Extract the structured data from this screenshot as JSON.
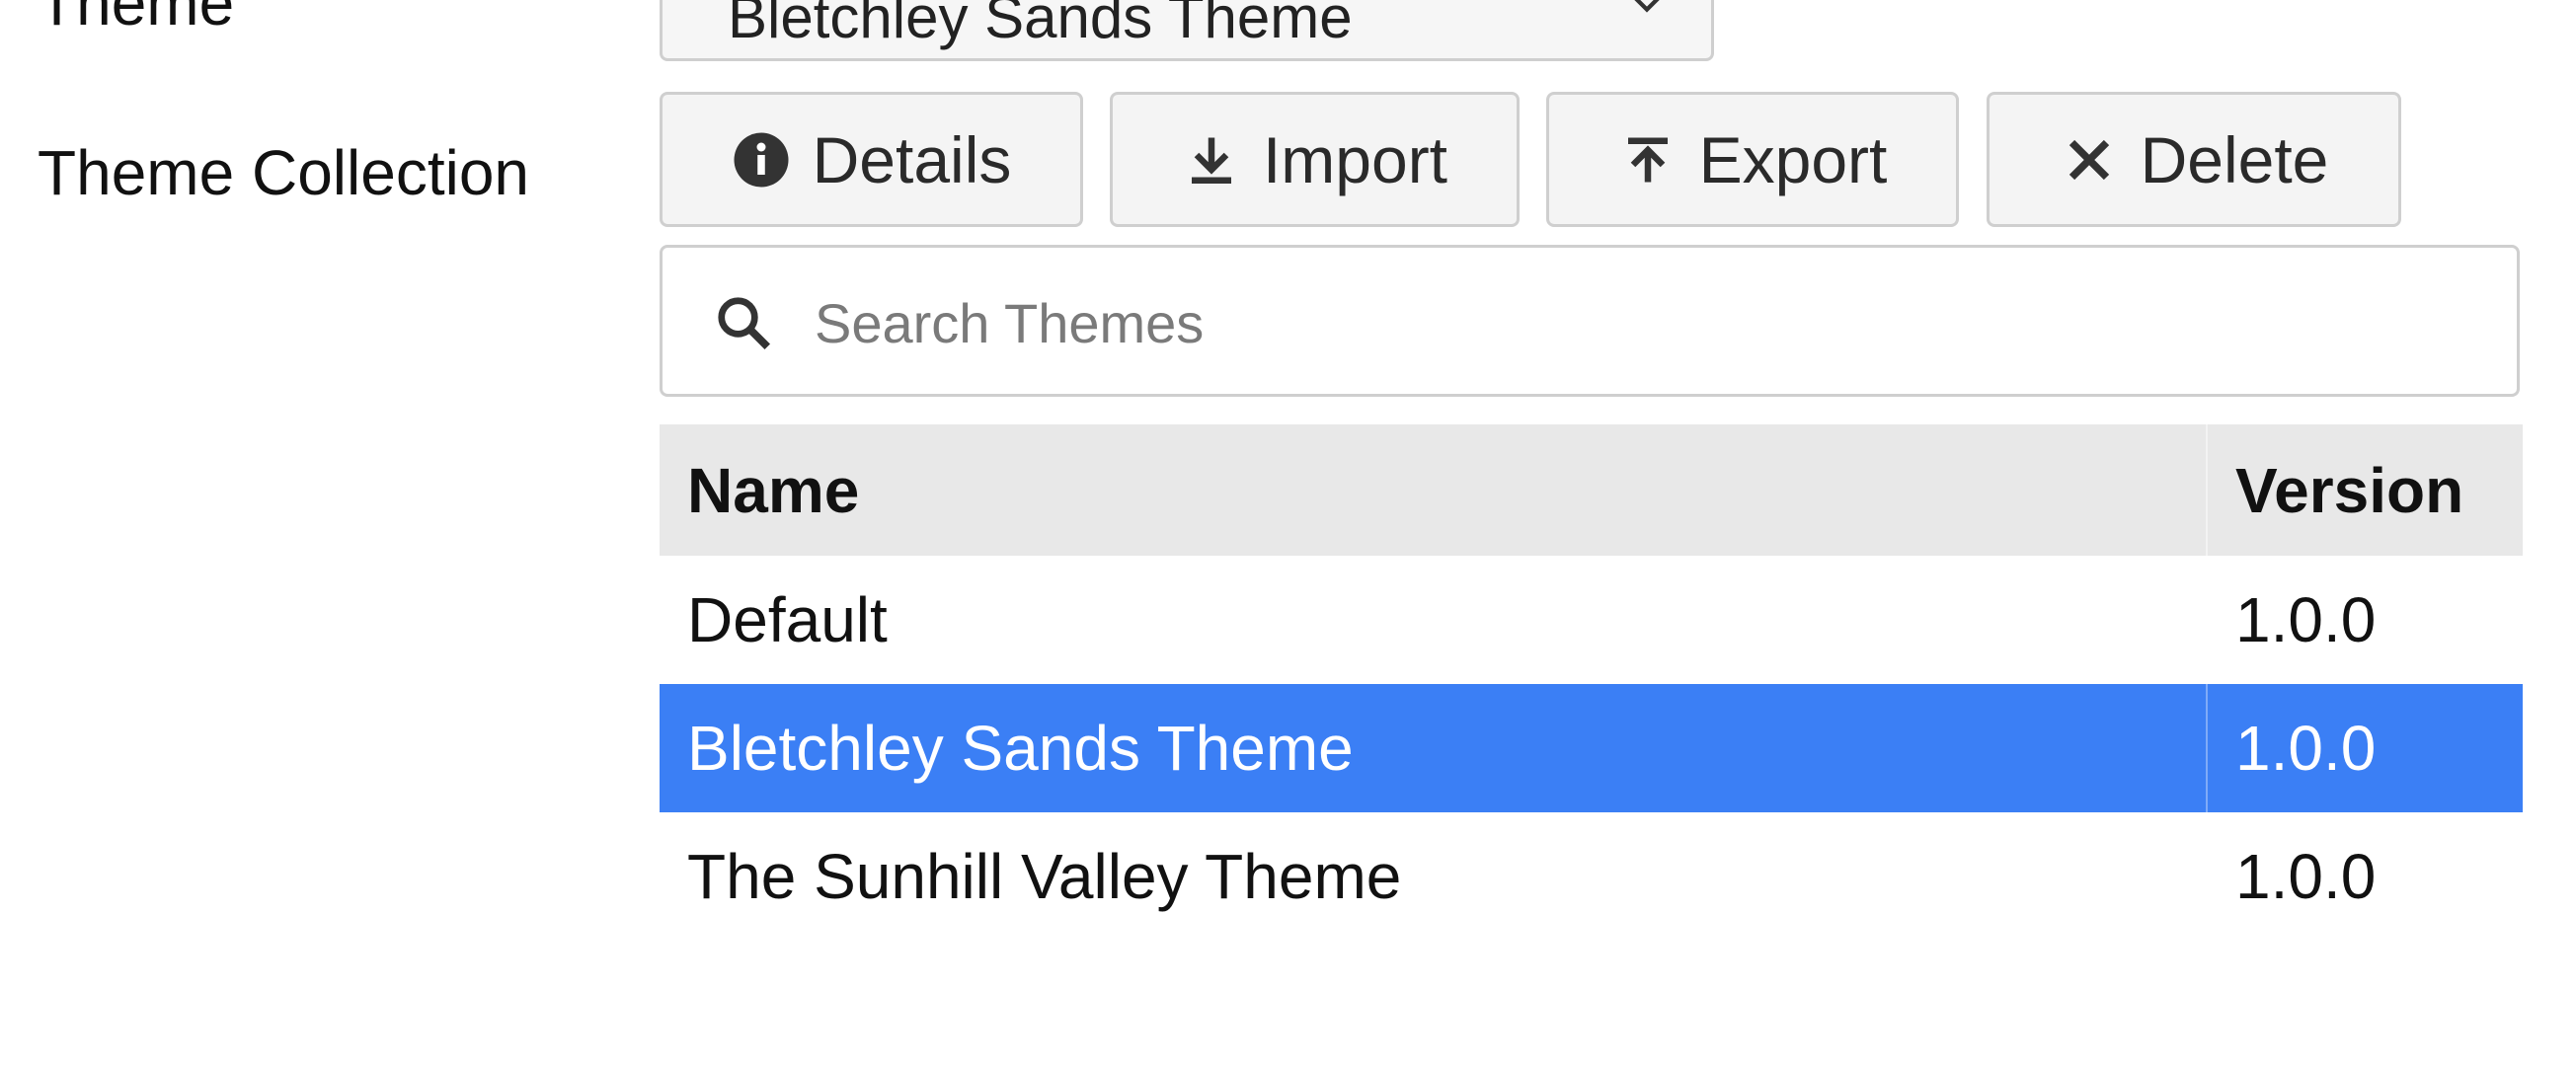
{
  "labels": {
    "theme": "Theme",
    "theme_collection": "Theme Collection"
  },
  "theme_select": {
    "value": "Bletchley Sands Theme",
    "icon": "chevron-down-icon"
  },
  "toolbar": {
    "details": {
      "label": "Details",
      "icon": "info-icon"
    },
    "import": {
      "label": "Import",
      "icon": "download-icon"
    },
    "export": {
      "label": "Export",
      "icon": "upload-icon"
    },
    "delete": {
      "label": "Delete",
      "icon": "close-icon"
    }
  },
  "search": {
    "placeholder": "Search Themes",
    "value": "",
    "icon": "search-icon"
  },
  "table": {
    "columns": [
      "Name",
      "Version"
    ],
    "rows": [
      {
        "name": "Default",
        "version": "1.0.0",
        "selected": false
      },
      {
        "name": "Bletchley Sands Theme",
        "version": "1.0.0",
        "selected": true
      },
      {
        "name": "The Sunhill Valley Theme",
        "version": "1.0.0",
        "selected": false
      }
    ]
  },
  "colors": {
    "selection": "#3b7ff5",
    "header_bg": "#e8e8e8",
    "button_bg": "#f4f4f4",
    "border": "#cfcfcf"
  }
}
